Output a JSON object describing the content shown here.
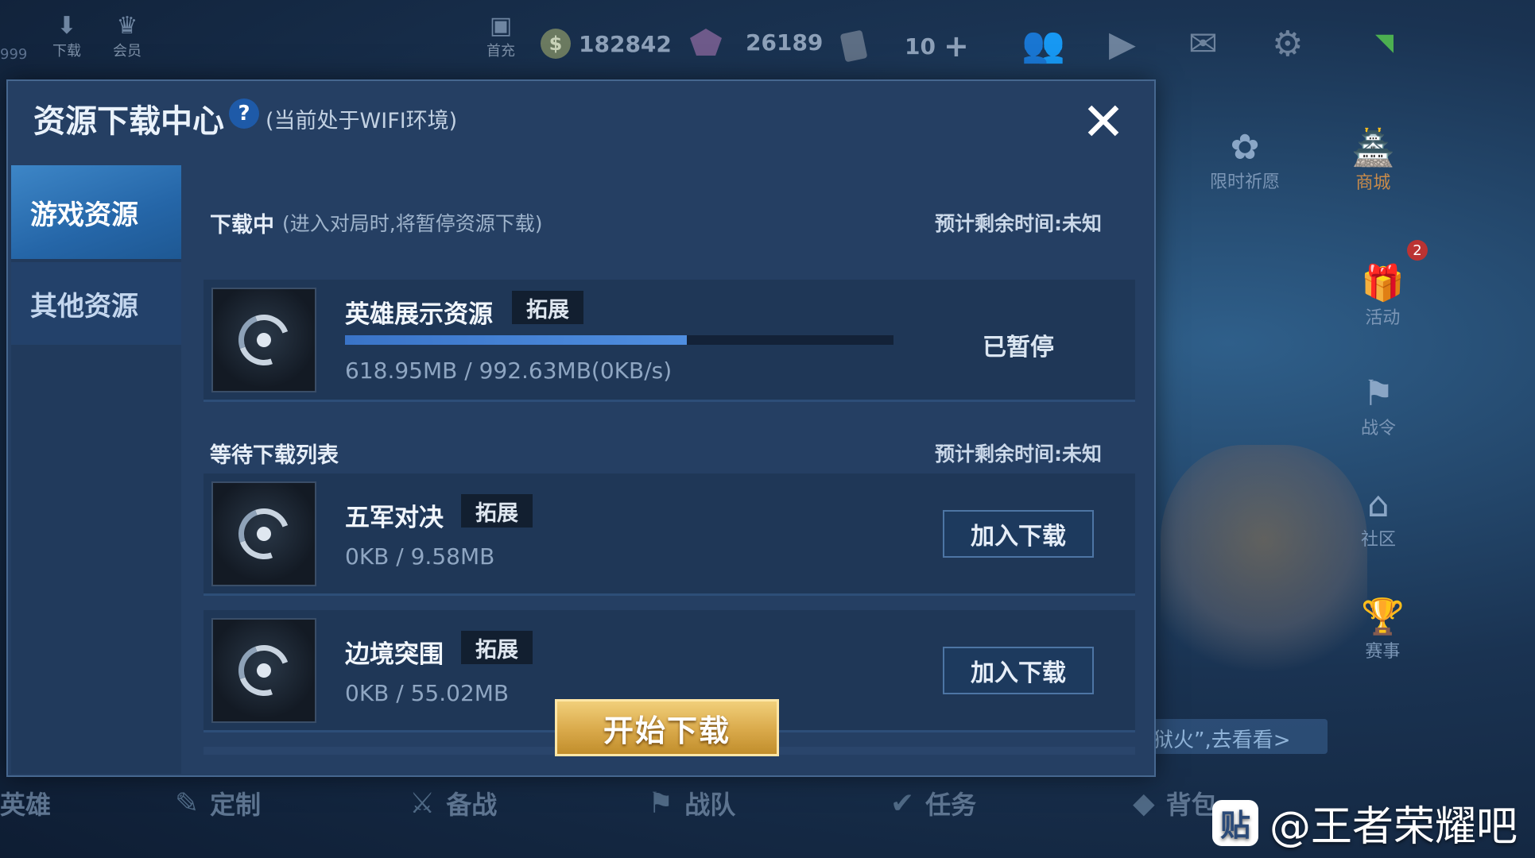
{
  "topbar": {
    "download_label": "下载",
    "member_label": "会员",
    "left_cut_text": "999",
    "first_charge_label": "首充",
    "gold": "182842",
    "diamonds": "26189",
    "tickets": "10",
    "add_symbol": "+"
  },
  "right_menu": {
    "limited_wish": "限时祈愿",
    "shop": "商城",
    "badge_count": "2",
    "activity": "活动",
    "battle_pass": "战令",
    "community": "社区",
    "tournament": "赛事",
    "notice_text": "狱火”,去看看>"
  },
  "bottom_nav": {
    "hero": "英雄",
    "customize": "定制",
    "prepare": "备战",
    "team": "战队",
    "tasks": "任务",
    "bag": "背包"
  },
  "watermark": {
    "logo_text": "贴",
    "text": "@王者荣耀吧"
  },
  "dialog": {
    "title": "资源下载中心",
    "help_symbol": "?",
    "subtitle": "(当前处于WIFI环境)",
    "close_symbol": "✕",
    "tabs": [
      {
        "label": "游戏资源"
      },
      {
        "label": "其他资源"
      }
    ],
    "downloading": {
      "title": "下载中",
      "note": "(进入对局时,将暂停资源下载)",
      "eta": "预计剩余时间:未知",
      "item": {
        "name": "英雄展示资源",
        "tag": "拓展",
        "size": "618.95MB / 992.63MB(0KB/s)",
        "progress": 0.6236,
        "status": "已暂停"
      }
    },
    "waiting": {
      "title": "等待下载列表",
      "eta": "预计剩余时间:未知",
      "items": [
        {
          "name": "五军对决",
          "tag": "拓展",
          "size": "0KB / 9.58MB",
          "button": "加入下载"
        },
        {
          "name": "边境突围",
          "tag": "拓展",
          "size": "0KB / 55.02MB",
          "button": "加入下载"
        }
      ]
    },
    "start_button": "开始下载"
  },
  "colors": {
    "dialog_bg": "#253f63",
    "active_tab": "#2e75bb",
    "progress_fill": "#4a86d8",
    "start_button": "#d9a94a"
  }
}
